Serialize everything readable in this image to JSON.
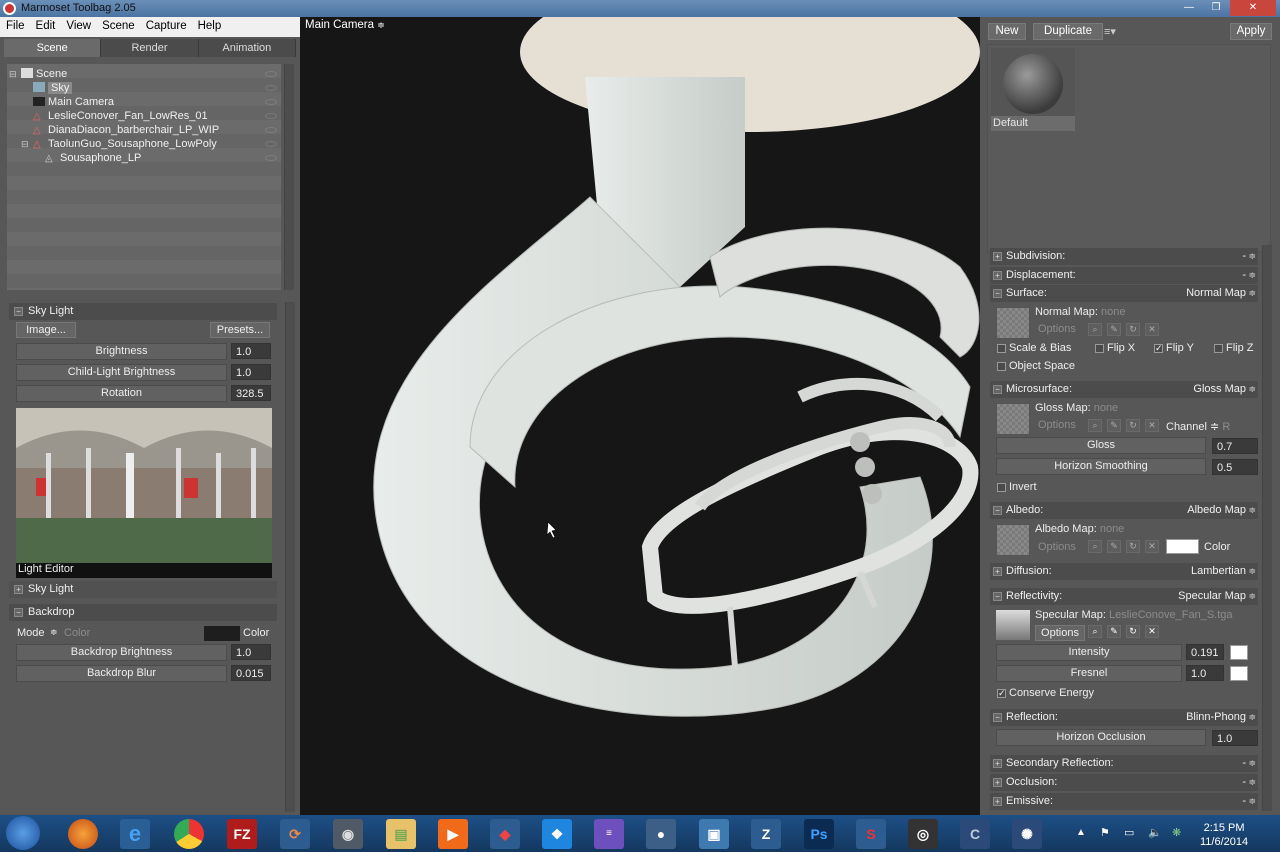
{
  "window": {
    "title": "Marmoset Toolbag 2.05",
    "controls": [
      "—",
      "❐",
      "✕"
    ]
  },
  "menu": [
    "File",
    "Edit",
    "View",
    "Scene",
    "Capture",
    "Help"
  ],
  "left": {
    "tabs": [
      "Scene",
      "Render",
      "Animation"
    ],
    "tree": [
      {
        "label": "Scene",
        "indent": 0,
        "exp": "⊟"
      },
      {
        "label": "Sky",
        "indent": 1,
        "exp": ""
      },
      {
        "label": "Main Camera",
        "indent": 1,
        "exp": ""
      },
      {
        "label": "LeslieConover_Fan_LowRes_01",
        "indent": 1,
        "exp": ""
      },
      {
        "label": "DianaDiacon_barberchair_LP_WIP",
        "indent": 1,
        "exp": ""
      },
      {
        "label": "TaolunGuo_Sousaphone_LowPoly",
        "indent": 1,
        "exp": "⊟"
      },
      {
        "label": "Sousaphone_LP",
        "indent": 2,
        "exp": ""
      }
    ],
    "skylight": {
      "header": "Sky Light",
      "image_btn": "Image...",
      "presets_btn": "Presets...",
      "brightness_label": "Brightness",
      "brightness": "1.0",
      "child_label": "Child-Light Brightness",
      "child": "1.0",
      "rotation_label": "Rotation",
      "rotation": "328.5",
      "light_editor": "Light Editor",
      "sky_light_sub": "Sky Light"
    },
    "backdrop": {
      "header": "Backdrop",
      "mode_label": "Mode",
      "mode_value": "Color",
      "color_label": "Color",
      "brightness_label": "Backdrop Brightness",
      "brightness": "1.0",
      "blur_label": "Backdrop Blur",
      "blur": "0.015"
    }
  },
  "viewport": {
    "camera": "Main Camera"
  },
  "right": {
    "new_btn": "New",
    "dup_btn": "Duplicate",
    "apply_btn": "Apply",
    "material": "Default",
    "subdivision": "Subdivision:",
    "displacement": "Displacement:",
    "surface": {
      "label": "Surface:",
      "mode": "Normal Map",
      "normal_map": "Normal Map:",
      "none": "none",
      "options": "Options",
      "scale_bias": "Scale & Bias",
      "flipx": "Flip X",
      "flipy": "Flip Y",
      "flipz": "Flip Z",
      "object_space": "Object Space"
    },
    "micro": {
      "label": "Microsurface:",
      "mode": "Gloss Map",
      "gloss_map": "Gloss Map:",
      "none": "none",
      "options": "Options",
      "channel": "Channel",
      "channel_val": "R",
      "gloss": "Gloss",
      "gloss_val": "0.7",
      "horizon": "Horizon Smoothing",
      "horizon_val": "0.5",
      "invert": "Invert"
    },
    "albedo": {
      "label": "Albedo:",
      "mode": "Albedo Map",
      "map": "Albedo Map:",
      "none": "none",
      "options": "Options",
      "color": "Color"
    },
    "diffusion": {
      "label": "Diffusion:",
      "mode": "Lambertian"
    },
    "reflectivity": {
      "label": "Reflectivity:",
      "mode": "Specular Map",
      "map": "Specular Map:",
      "file": "LeslieConove_Fan_S.tga",
      "options": "Options",
      "intensity": "Intensity",
      "intensity_val": "0.191",
      "fresnel": "Fresnel",
      "fresnel_val": "1.0",
      "conserve": "Conserve Energy"
    },
    "reflection": {
      "label": "Reflection:",
      "mode": "Blinn-Phong",
      "horizon_occ": "Horizon Occlusion",
      "horizon_occ_val": "1.0"
    },
    "secondary": "Secondary Reflection:",
    "occlusion": "Occlusion:",
    "emissive": "Emissive:"
  },
  "taskbar": {
    "time": "2:15 PM",
    "date": "11/6/2014"
  },
  "colors": {
    "accent": "#4c74a3",
    "panel": "#575757",
    "viewport": "#161616"
  }
}
